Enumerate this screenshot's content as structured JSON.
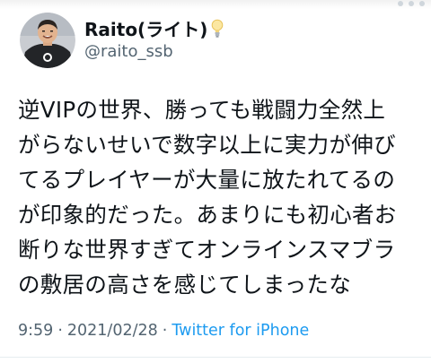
{
  "user": {
    "display_name": "Raito(ライト)",
    "handle": "@raito_ssb",
    "avatar_icon": "user-avatar-photo",
    "badge_icon": "lightbulb-icon"
  },
  "tweet": {
    "lines": [
      "逆VIPの世界、勝っても戦闘力全然上",
      "がらないせいで数字以上に実力が伸び",
      "てるプレイヤーが大量に放たれてるの",
      "が印象的だった。あまりにも初心者お",
      "断りな世界すぎてオンラインスマブラ",
      "の敷居の高さを感じてしまったな"
    ]
  },
  "meta": {
    "time": "9:59",
    "separator": "·",
    "date": "2021/02/28",
    "source": "Twitter for iPhone"
  },
  "colors": {
    "text": "#0f1419",
    "secondary": "#536471",
    "link": "#1d9bf0",
    "bulb": "#f5c542"
  }
}
